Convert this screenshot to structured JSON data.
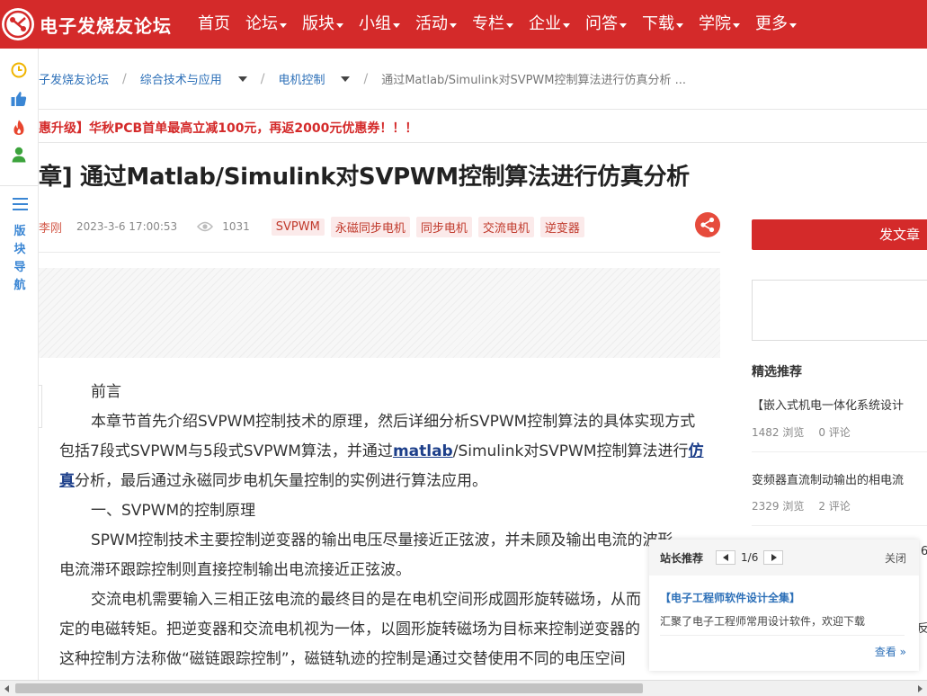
{
  "site": {
    "name": "电子发烧友论坛"
  },
  "nav": {
    "items": [
      {
        "label": "首页",
        "dropdown": false
      },
      {
        "label": "论坛",
        "dropdown": true
      },
      {
        "label": "版块",
        "dropdown": true
      },
      {
        "label": "小组",
        "dropdown": true
      },
      {
        "label": "活动",
        "dropdown": true
      },
      {
        "label": "专栏",
        "dropdown": true
      },
      {
        "label": "企业",
        "dropdown": true
      },
      {
        "label": "问答",
        "dropdown": true
      },
      {
        "label": "下载",
        "dropdown": true
      },
      {
        "label": "学院",
        "dropdown": true
      },
      {
        "label": "更多",
        "dropdown": true
      }
    ]
  },
  "leftbar": {
    "nav_label": [
      "版",
      "块",
      "导",
      "航"
    ]
  },
  "breadcrumb": {
    "home": "子发烧友论坛",
    "section": "综合技术与应用",
    "board": "电机控制",
    "current": "通过Matlab/Simulink对SVPWM控制算法进行仿真分析 ..."
  },
  "promo": "惠升级】华秋PCB首单最高立减100元，再返2000元优惠券！！！",
  "article": {
    "title": "章] 通过Matlab/Simulink对SVPWM控制算法进行仿真分析",
    "author": "李刚",
    "time": "2023-3-6 17:00:53",
    "views": "1031",
    "tags": [
      "SVPWM",
      "永磁同步电机",
      "同步电机",
      "交流电机",
      "逆变器"
    ],
    "body": {
      "p1": "前言",
      "p2": "本章节首先介绍SVPWM控制技术的原理，然后详细分析SVPWM控制算法的具体实现方式",
      "p3a": "包括7段式SVPWM与5段式SVPWM算法，并通过",
      "p3kw": "matlab",
      "p3b": "/Simulink对SVPWM控制算法进行",
      "p3kw2": "仿",
      "p4kw": "真",
      "p4": "分析，最后通过永磁同步电机矢量控制的实例进行算法应用。",
      "p5": "一、SVPWM的控制原理",
      "p6": "SPWM控制技术主要控制逆变器的输出电压尽量接近正弦波，并未顾及输出电流的波形",
      "p7": "电流滞环跟踪控制则直接控制输出电流接近正弦波。",
      "p8": "交流电机需要输入三相正弦电流的最终目的是在电机空间形成圆形旋转磁场，从而",
      "p9": "定的电磁转矩。把逆变器和交流电机视为一体，以圆形旋转磁场为目标来控制逆变器的",
      "p10": "这种控制方法称做“磁链跟踪控制”，磁链轨迹的控制是通过交替使用不同的电压空间"
    }
  },
  "sidebar": {
    "post_button": "发文章",
    "rec_title": "精选推荐",
    "items": [
      {
        "title": "【嵌入式机电一体化系统设计",
        "views": "1482 浏览",
        "comments": "0 评论"
      },
      {
        "title": "变频器直流制动输出的相电流",
        "views": "2329 浏览",
        "comments": "2 评论"
      }
    ],
    "peek_a": "6",
    "peek_b": "反"
  },
  "popup": {
    "label": "站长推荐",
    "page": "1/6",
    "close": "关闭",
    "title": "【电子工程师软件设计全集】",
    "desc": "汇聚了电子工程师常用设计软件，欢迎下载",
    "more": "查看 »"
  },
  "colors": {
    "brand": "#d42a2a",
    "link": "#2d70b8"
  }
}
